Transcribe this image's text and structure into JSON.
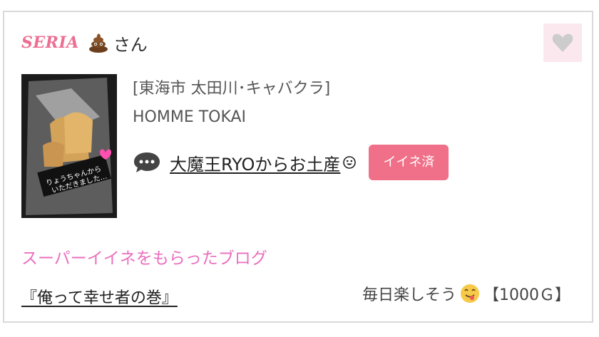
{
  "user": {
    "name": "SERIA",
    "suffix": "さん",
    "emoji": "poo-emoji"
  },
  "like_button": {
    "icon": "heart-icon",
    "color": "#cccccc",
    "bg": "#fbe8ee"
  },
  "shop": {
    "location": "[東海市 太田川･キャバクラ]",
    "name": "HOMME TOKAI"
  },
  "thumbnail": {
    "caption_line1": "りょうちゃんから",
    "caption_line2": "いただきました…"
  },
  "post": {
    "title": "大魔王RYOからお土産",
    "title_emoji": "smiley-emoji",
    "badge": "イイネ済",
    "icon": "speech-bubble-icon"
  },
  "super_iine": {
    "label": "スーパーイイネをもらったブログ"
  },
  "blog": {
    "title": "『俺って幸せ者の巻』",
    "comment": "毎日楽しそう",
    "emoji": "yum-emoji",
    "reward": "【1000Ｇ】"
  },
  "colors": {
    "accent_pink": "#ec6f92",
    "badge_pink": "#ef7088",
    "section_pink": "#ea6fbe",
    "border": "#d9d9d9"
  }
}
